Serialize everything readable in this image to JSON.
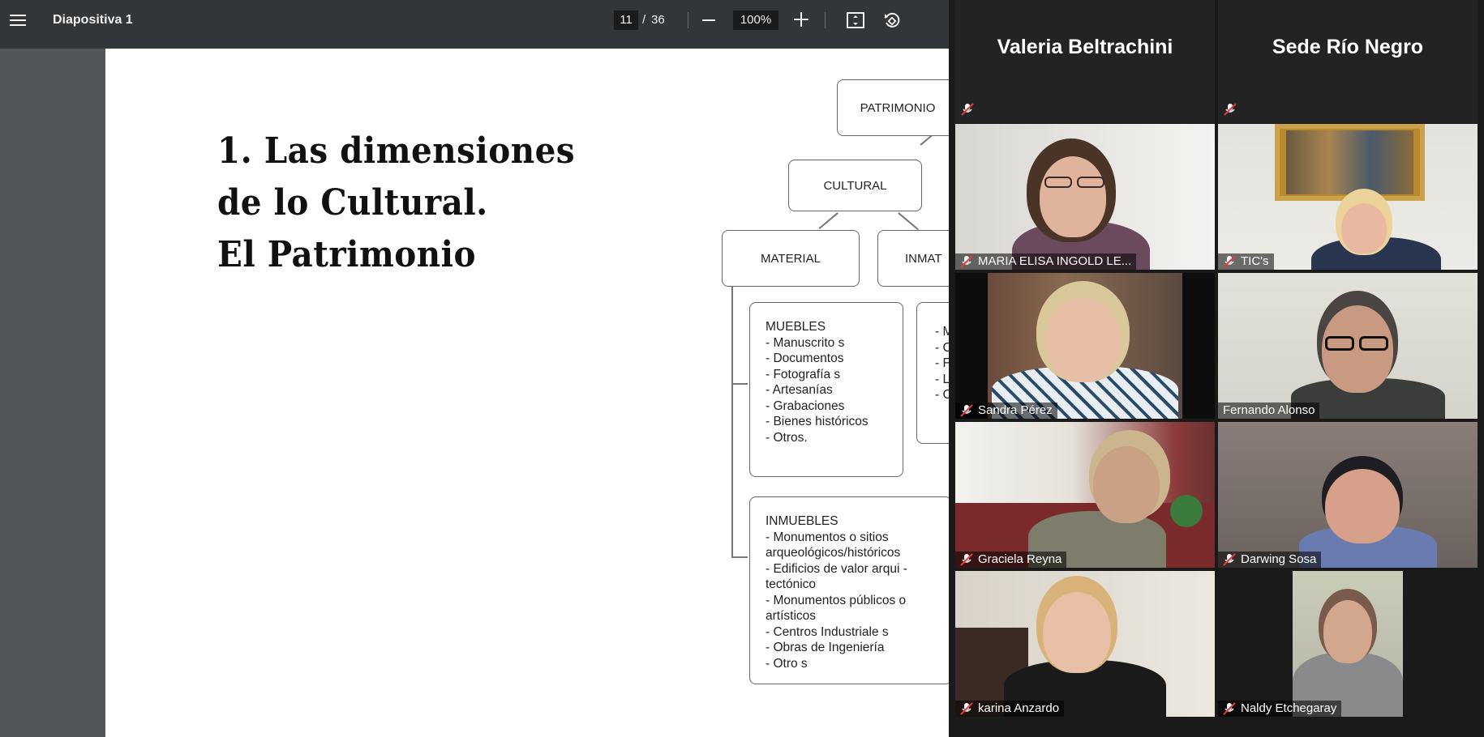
{
  "toolbar": {
    "title": "Diapositiva 1",
    "current_page": "11",
    "separator": "/",
    "total_pages": "36",
    "zoom": "100%"
  },
  "slide": {
    "title_lines": [
      "1. Las dimensiones",
      "de lo Cultural.",
      "El Patrimonio"
    ],
    "diagram": {
      "root": "PATRIMONIO",
      "level1": "CULTURAL",
      "material": "MATERIAL",
      "inmaterial": "INMAT",
      "muebles_title": "MUEBLES",
      "muebles_items": [
        "- Manuscrito s",
        "- Documentos",
        "- Fotografía s",
        "- Artesanías",
        "- Grabaciones",
        "- Bienes históricos",
        "- Otros."
      ],
      "inmuebles_title": "INMUEBLES",
      "inmuebles_items": [
        "- Monumentos o sitios",
        "arqueológicos/históricos",
        "- Edificios de valor arqui -",
        "tectónico",
        "- Monumentos públicos o",
        "artísticos",
        "- Centros Industriale s",
        "- Obras de Ingeniería",
        "- Otro s"
      ],
      "inmat_items": [
        "- M",
        "- C",
        "- F",
        "- L",
        "- C"
      ]
    }
  },
  "meeting": {
    "name_tiles": [
      "Valeria Beltrachini",
      "Sede Río Negro"
    ],
    "participants": [
      "MARIA ELISA INGOLD LE...",
      "TIC's",
      "Sandra Pérez",
      "Fernando Alonso",
      "Graciela Reyna",
      "Darwing Sosa",
      "karina Anzardo",
      "Naldy Etchegaray"
    ],
    "active_speaker_color": "#d5e37f",
    "mute_color": "#e23d3d"
  }
}
